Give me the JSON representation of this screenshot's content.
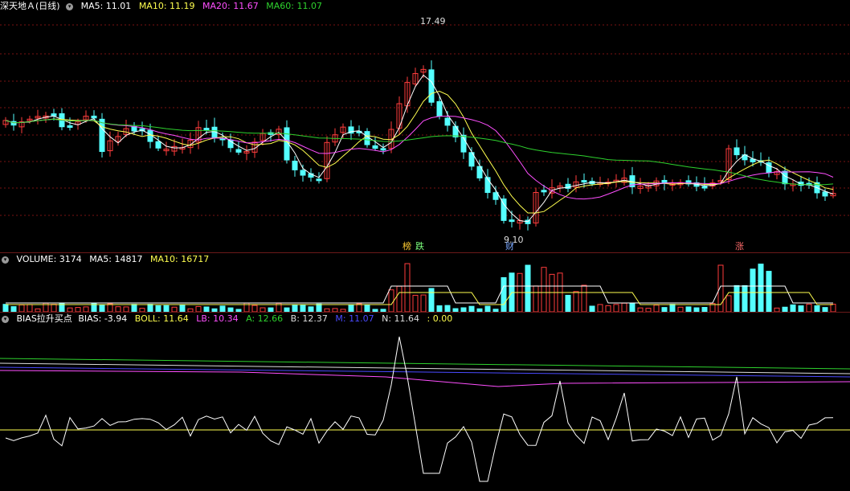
{
  "kline_header": {
    "title": "深天地Ａ(日线)",
    "ma5": "MA5: 11.01",
    "ma10": "MA10: 11.19",
    "ma20": "MA20: 11.67",
    "ma60": "MA60: 11.07"
  },
  "kline_marks": {
    "high_label": "17.49",
    "low_label": "9.10",
    "tag_bang": "榜",
    "tag_die": "跌",
    "tag_cai": "财",
    "tag_zhang": "涨"
  },
  "volume_header": {
    "title": "VOLUME: 3174",
    "ma5": "MA5: 14817",
    "ma10": "MA10: 16717"
  },
  "bias_header": {
    "title": "BIAS拉升买点",
    "bias": "BIAS: -3.94",
    "boll": "BOLL: 11.64",
    "lb": "LB: 10.34",
    "a": "A: 12.66",
    "b": "B: 12.37",
    "m": "M: 11.07",
    "n": "N: 11.64",
    "z": ": 0.00"
  },
  "colors": {
    "up": "#ff3d3d",
    "down": "#54ffff",
    "ma5": "#ffffff",
    "ma10": "#ffff4f",
    "ma20": "#ff4fff",
    "ma60": "#2ed22e",
    "grid": "#7a1212"
  },
  "icons": [
    "collapse-circle-icon"
  ]
}
